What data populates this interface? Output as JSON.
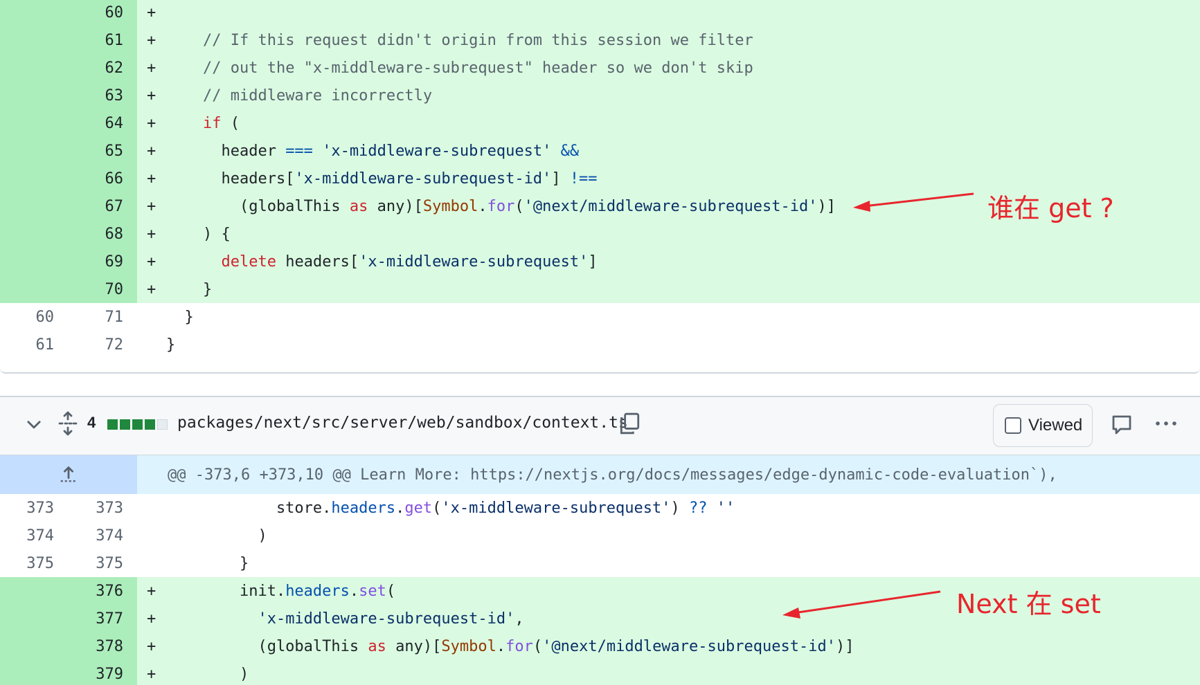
{
  "top_diff": {
    "rows": [
      {
        "old": "",
        "new": "60",
        "type": "add",
        "marker": "+",
        "tokens": []
      },
      {
        "old": "",
        "new": "61",
        "type": "add",
        "marker": "+",
        "tokens": [
          {
            "c": "",
            "t": "    "
          },
          {
            "c": "cm",
            "t": "// If this request didn't origin from this session we filter"
          }
        ]
      },
      {
        "old": "",
        "new": "62",
        "type": "add",
        "marker": "+",
        "tokens": [
          {
            "c": "",
            "t": "    "
          },
          {
            "c": "cm",
            "t": "// out the \"x-middleware-subrequest\" header so we don't skip"
          }
        ]
      },
      {
        "old": "",
        "new": "63",
        "type": "add",
        "marker": "+",
        "tokens": [
          {
            "c": "",
            "t": "    "
          },
          {
            "c": "cm",
            "t": "// middleware incorrectly"
          }
        ]
      },
      {
        "old": "",
        "new": "64",
        "type": "add",
        "marker": "+",
        "tokens": [
          {
            "c": "",
            "t": "    "
          },
          {
            "c": "kw",
            "t": "if"
          },
          {
            "c": "",
            "t": " ("
          }
        ]
      },
      {
        "old": "",
        "new": "65",
        "type": "add",
        "marker": "+",
        "tokens": [
          {
            "c": "",
            "t": "      header "
          },
          {
            "c": "op",
            "t": "==="
          },
          {
            "c": "",
            "t": " "
          },
          {
            "c": "str",
            "t": "'x-middleware-subrequest'"
          },
          {
            "c": "",
            "t": " "
          },
          {
            "c": "op",
            "t": "&&"
          }
        ]
      },
      {
        "old": "",
        "new": "66",
        "type": "add",
        "marker": "+",
        "tokens": [
          {
            "c": "",
            "t": "      headers["
          },
          {
            "c": "str",
            "t": "'x-middleware-subrequest-id'"
          },
          {
            "c": "",
            "t": "] "
          },
          {
            "c": "op",
            "t": "!=="
          }
        ]
      },
      {
        "old": "",
        "new": "67",
        "type": "add",
        "marker": "+",
        "tokens": [
          {
            "c": "",
            "t": "        (globalThis "
          },
          {
            "c": "kw",
            "t": "as"
          },
          {
            "c": "",
            "t": " any)["
          },
          {
            "c": "sym",
            "t": "Symbol"
          },
          {
            "c": "",
            "t": "."
          },
          {
            "c": "fn",
            "t": "for"
          },
          {
            "c": "",
            "t": "("
          },
          {
            "c": "str",
            "t": "'@next/middleware-subrequest-id'"
          },
          {
            "c": "",
            "t": ")]"
          }
        ]
      },
      {
        "old": "",
        "new": "68",
        "type": "add",
        "marker": "+",
        "tokens": [
          {
            "c": "",
            "t": "    ) {"
          }
        ]
      },
      {
        "old": "",
        "new": "69",
        "type": "add",
        "marker": "+",
        "tokens": [
          {
            "c": "",
            "t": "      "
          },
          {
            "c": "kw",
            "t": "delete"
          },
          {
            "c": "",
            "t": " headers["
          },
          {
            "c": "str",
            "t": "'x-middleware-subrequest'"
          },
          {
            "c": "",
            "t": "]"
          }
        ]
      },
      {
        "old": "",
        "new": "70",
        "type": "add",
        "marker": "+",
        "tokens": [
          {
            "c": "",
            "t": "    }"
          }
        ]
      },
      {
        "old": "60",
        "new": "71",
        "type": "ctx",
        "marker": " ",
        "tokens": [
          {
            "c": "",
            "t": "  }"
          }
        ]
      },
      {
        "old": "61",
        "new": "72",
        "type": "ctx",
        "marker": " ",
        "tokens": [
          {
            "c": "",
            "t": "}"
          }
        ]
      }
    ]
  },
  "file_header": {
    "changes_count": "4",
    "path": "packages/next/src/server/web/sandbox/context.ts",
    "viewed_label": "Viewed"
  },
  "hunk": {
    "header": "@@ -373,6 +373,10 @@ Learn More: https://nextjs.org/docs/messages/edge-dynamic-code-evaluation`),"
  },
  "bottom_diff": {
    "rows": [
      {
        "old": "373",
        "new": "373",
        "type": "ctx",
        "marker": " ",
        "tokens": [
          {
            "c": "",
            "t": "            store."
          },
          {
            "c": "op",
            "t": "headers"
          },
          {
            "c": "",
            "t": "."
          },
          {
            "c": "fn",
            "t": "get"
          },
          {
            "c": "",
            "t": "("
          },
          {
            "c": "str",
            "t": "'x-middleware-subrequest'"
          },
          {
            "c": "",
            "t": ") "
          },
          {
            "c": "op",
            "t": "??"
          },
          {
            "c": "",
            "t": " "
          },
          {
            "c": "str",
            "t": "''"
          }
        ]
      },
      {
        "old": "374",
        "new": "374",
        "type": "ctx",
        "marker": " ",
        "tokens": [
          {
            "c": "",
            "t": "          )"
          }
        ]
      },
      {
        "old": "375",
        "new": "375",
        "type": "ctx",
        "marker": " ",
        "tokens": [
          {
            "c": "",
            "t": "        }"
          }
        ]
      },
      {
        "old": "",
        "new": "376",
        "type": "add",
        "marker": "+",
        "tokens": [
          {
            "c": "",
            "t": "        init."
          },
          {
            "c": "op",
            "t": "headers"
          },
          {
            "c": "",
            "t": "."
          },
          {
            "c": "fn",
            "t": "set"
          },
          {
            "c": "",
            "t": "("
          }
        ]
      },
      {
        "old": "",
        "new": "377",
        "type": "add",
        "marker": "+",
        "tokens": [
          {
            "c": "",
            "t": "          "
          },
          {
            "c": "str",
            "t": "'x-middleware-subrequest-id'"
          },
          {
            "c": "",
            "t": ","
          }
        ]
      },
      {
        "old": "",
        "new": "378",
        "type": "add",
        "marker": "+",
        "tokens": [
          {
            "c": "",
            "t": "          (globalThis "
          },
          {
            "c": "kw",
            "t": "as"
          },
          {
            "c": "",
            "t": " any)["
          },
          {
            "c": "sym",
            "t": "Symbol"
          },
          {
            "c": "",
            "t": "."
          },
          {
            "c": "fn",
            "t": "for"
          },
          {
            "c": "",
            "t": "("
          },
          {
            "c": "str",
            "t": "'@next/middleware-subrequest-id'"
          },
          {
            "c": "",
            "t": ")]"
          }
        ]
      },
      {
        "old": "",
        "new": "379",
        "type": "add",
        "marker": "+",
        "tokens": [
          {
            "c": "",
            "t": "        )"
          }
        ]
      }
    ]
  },
  "annotations": {
    "top": "谁在 get ?",
    "bottom": "Next 在 set",
    "color": "#e8252d"
  },
  "icons": {
    "collapse": "chevron-down-icon",
    "expand": "unfold-icon",
    "copy": "copy-icon",
    "comment": "comment-icon",
    "more": "kebab-horizontal-icon",
    "hunk_expand": "expand-up-icon"
  }
}
